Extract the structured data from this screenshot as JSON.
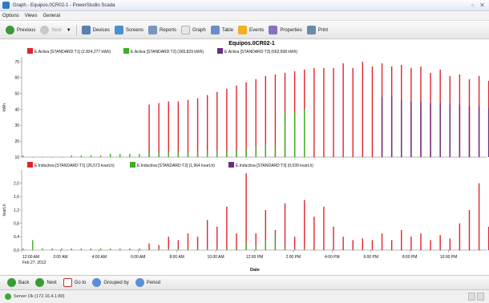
{
  "window": {
    "title": "Graph - Equipos.0CR02-1 - PowerStudio Scada"
  },
  "menu": [
    "Options",
    "Views",
    "General"
  ],
  "toolbar": {
    "previous": "Previous",
    "next": "Next",
    "devices": "Devices",
    "screens": "Screens",
    "reports": "Reports",
    "graph": "Graph",
    "table": "Table",
    "events": "Events",
    "properties": "Properties",
    "print": "Print"
  },
  "bottom": {
    "back": "Back",
    "next": "Next",
    "goto": "Go to",
    "grouped_by": "Grouped by",
    "period": "Period"
  },
  "status": {
    "text": "Server Ok (172.16.4.1:80)"
  },
  "colors": {
    "t1": "#e0242b",
    "t2": "#3caf23",
    "t3": "#6c2d84"
  },
  "chart_data": [
    {
      "type": "bar",
      "title": "Equipos.0CR02-1",
      "ylabel": "kWh",
      "ylim": [
        10,
        73
      ],
      "yticks": [
        "70",
        "60",
        "50",
        "40",
        "30",
        "20",
        "10"
      ],
      "legend": [
        "E.Activa [STANDARD:T1] (2.824,277 kWh)",
        "E.Activa [STANDARD:T2] (365,829 kWh)",
        "E.Activa [STANDARD:T3] (662,698 kWh)"
      ],
      "series": [
        {
          "name": "E.Activa [STANDARD:T1]",
          "tariff": "t1",
          "start_hour": 6.5,
          "values": [
            43,
            44,
            45,
            45,
            46,
            47,
            49,
            51,
            53,
            55,
            57,
            59,
            61,
            62,
            63,
            64,
            65,
            66,
            66,
            66,
            69,
            66,
            70,
            67,
            69,
            67,
            68,
            66,
            67,
            63,
            65,
            61,
            62,
            59,
            61,
            58,
            59,
            59,
            58,
            58,
            58,
            59,
            58,
            57,
            56,
            54,
            54,
            50,
            49
          ]
        },
        {
          "name": "E.Activa [STANDARD:T2]",
          "tariff": "t2",
          "start_hour": 0,
          "values": [
            11,
            10,
            10,
            10,
            10,
            11,
            11,
            11,
            11,
            12,
            12,
            12,
            12,
            13,
            13,
            13,
            13,
            14,
            14,
            14,
            14,
            14,
            15,
            15,
            17,
            18,
            17,
            37,
            38,
            40
          ]
        },
        {
          "name": "E.Activa [STANDARD:T3]",
          "tariff": "t3",
          "start_hour": 18.5,
          "values": [
            48,
            48,
            46,
            45,
            45,
            44,
            44,
            43,
            43,
            42,
            42,
            41,
            41,
            40,
            39,
            39,
            38,
            15,
            14,
            14,
            13,
            13,
            13,
            13,
            13,
            13
          ]
        }
      ]
    },
    {
      "type": "bar",
      "ylabel": "kvarLh",
      "ylim": [
        0,
        2.4
      ],
      "yticks": [
        "2,0",
        "1,6",
        "1,2",
        "0,8",
        "0,4",
        "0,0"
      ],
      "xticks": [
        "12:00 AM",
        "2:00 AM",
        "4:00 AM",
        "6:00 AM",
        "8:00 AM",
        "10:00 AM",
        "12:00 PM",
        "2:00 PM",
        "4:00 PM",
        "6:00 PM",
        "8:00 PM",
        "10:00 PM"
      ],
      "xdate": "Feb 27, 2012",
      "xlabel": "Date",
      "legend": [
        "E.Inductiva [STANDARD:T1] (26,573 kvarLh)",
        "E.Inductiva [STANDARD:T2] (1,964 kvarLh)",
        "E.Inductiva [STANDARD:T3] (0,039 kvarLh)"
      ],
      "series": [
        {
          "name": "E.Inductiva [STANDARD:T1]",
          "tariff": "t1",
          "start_hour": 6.5,
          "values": [
            0.2,
            0.15,
            0.4,
            0.3,
            0.5,
            0.4,
            0.9,
            0.7,
            1.3,
            0.5,
            2.3,
            0.5,
            1.2,
            0.6,
            1.4,
            0.4,
            1.5,
            1.0,
            1.3,
            0.7,
            0.4,
            0.3,
            0.35,
            0.3,
            0.5,
            0.3,
            0.6,
            0.4,
            0.5,
            0.3,
            0.45,
            0.35,
            0.8,
            1.2,
            2.0,
            0.7,
            0.5,
            0.3,
            0.7,
            0.5,
            0.6,
            0.8,
            0.6,
            0.5,
            0.4,
            0.3,
            0.2,
            0.15,
            0.1
          ]
        },
        {
          "name": "E.Inductiva [STANDARD:T2]",
          "tariff": "t2",
          "start_hour": 0,
          "values": [
            0.05,
            0.3,
            0.05,
            0.05,
            0.05,
            0.05,
            0.05,
            0.05,
            0.05,
            0.05,
            0.05,
            0.05,
            0.05,
            0.05,
            0.05,
            0.05,
            0.05,
            0.05,
            0.05,
            0.05,
            0.05,
            0.05,
            0.05,
            0.2,
            0.15,
            0.3,
            0.5,
            0.1,
            0.05,
            0.05
          ]
        },
        {
          "name": "E.Inductiva [STANDARD:T3]",
          "tariff": "t3",
          "start_hour": 18.5,
          "values": [
            0.01,
            0.01,
            0.01,
            0.01,
            0.01,
            0.01,
            0.01,
            0.01,
            0.01,
            0.01,
            0.01,
            0.01,
            0.01,
            0.01,
            0.01,
            0.01,
            0.01,
            0.01,
            0.01,
            0.01,
            0.01,
            0.01,
            0.01,
            0.01,
            0.01,
            0.01
          ]
        }
      ]
    }
  ]
}
